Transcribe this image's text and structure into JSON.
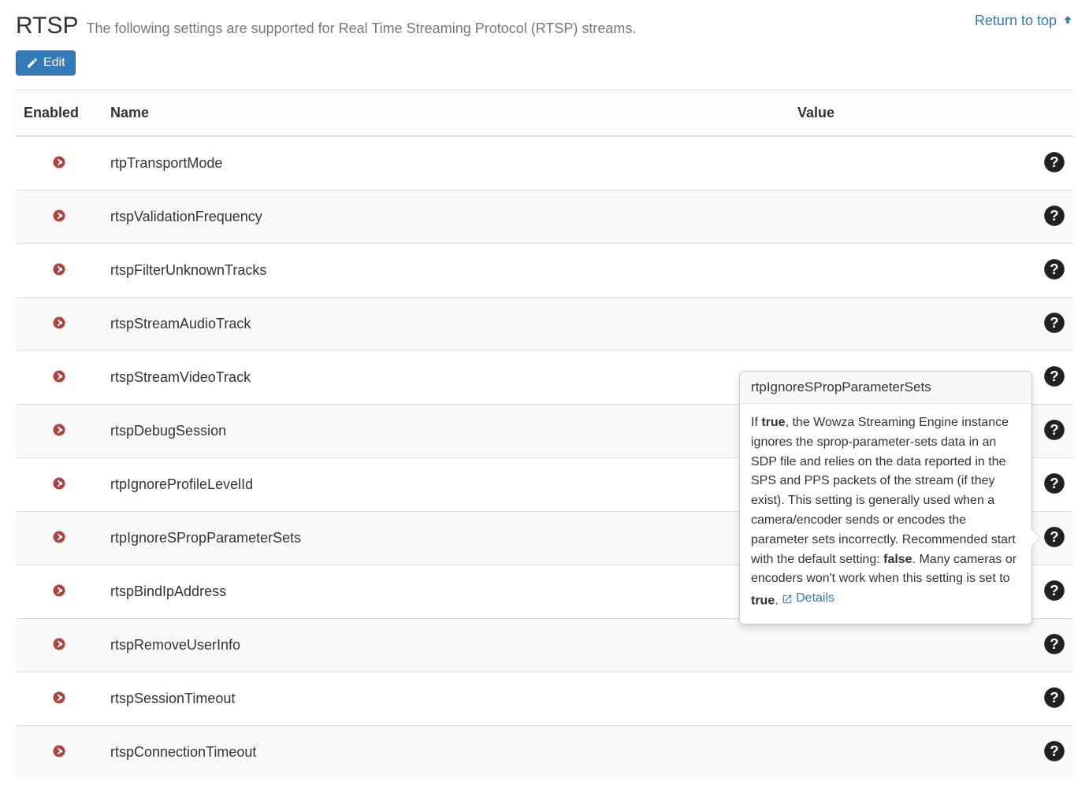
{
  "header": {
    "title": "RTSP",
    "subtitle": "The following settings are supported for Real Time Streaming Protocol (RTSP) streams.",
    "return_label": "Return to top"
  },
  "toolbar": {
    "edit_label": "Edit"
  },
  "table": {
    "columns": {
      "enabled": "Enabled",
      "name": "Name",
      "value": "Value"
    },
    "rows": [
      {
        "enabled": false,
        "name": "rtpTransportMode",
        "value": ""
      },
      {
        "enabled": false,
        "name": "rtspValidationFrequency",
        "value": ""
      },
      {
        "enabled": false,
        "name": "rtspFilterUnknownTracks",
        "value": ""
      },
      {
        "enabled": false,
        "name": "rtspStreamAudioTrack",
        "value": ""
      },
      {
        "enabled": false,
        "name": "rtspStreamVideoTrack",
        "value": ""
      },
      {
        "enabled": false,
        "name": "rtspDebugSession",
        "value": ""
      },
      {
        "enabled": false,
        "name": "rtpIgnoreProfileLevelId",
        "value": ""
      },
      {
        "enabled": false,
        "name": "rtpIgnoreSPropParameterSets",
        "value": ""
      },
      {
        "enabled": false,
        "name": "rtspBindIpAddress",
        "value": ""
      },
      {
        "enabled": false,
        "name": "rtspRemoveUserInfo",
        "value": ""
      },
      {
        "enabled": false,
        "name": "rtspSessionTimeout",
        "value": ""
      },
      {
        "enabled": false,
        "name": "rtspConnectionTimeout",
        "value": ""
      }
    ]
  },
  "popover": {
    "visible": true,
    "anchor_row_index": 7,
    "title": "rtpIgnoreSPropParameterSets",
    "body_pre": "If ",
    "body_b1": "true",
    "body_mid1": ", the Wowza Streaming Engine instance ignores the sprop-parameter-sets data in an SDP file and relies on the data reported in the SPS and PPS packets of the stream (if they exist). This setting is generally used when a camera/encoder sends or encodes the parameter sets incorrectly. Recommended start with the default setting: ",
    "body_b2": "false",
    "body_mid2": ". Many cameras or encoders won't work when this setting is set to ",
    "body_b3": "true",
    "body_post": ". ",
    "details_label": "Details"
  }
}
